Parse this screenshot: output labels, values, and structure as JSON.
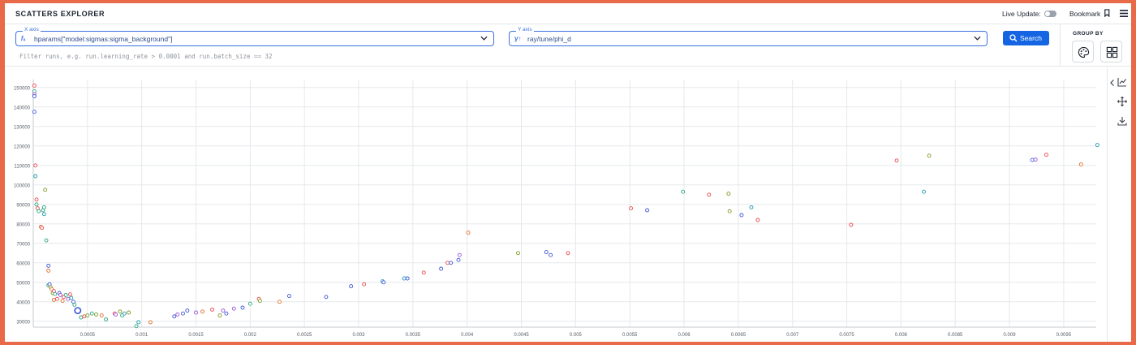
{
  "header": {
    "title": "SCATTERS EXPLORER",
    "live_update_label": "Live Update:",
    "bookmark_label": "Bookmark"
  },
  "controls": {
    "x_axis": {
      "label": "X axis",
      "value": "hparams[\"model:sigmas:sigma_background\"]",
      "icon": "function-icon"
    },
    "y_axis": {
      "label": "Y axis",
      "value": "ray/tune/phi_d",
      "icon": "metric-icon"
    },
    "search_label": "Search",
    "filter_placeholder": "Filter runs, e.g. run.learning_rate > 0.0001 and run.batch_size == 32",
    "group_by_label": "GROUP BY"
  },
  "colors": {
    "accent": "#1565e3",
    "series": [
      "#e8474f",
      "#3c54d6",
      "#2aa37a",
      "#7a9a21",
      "#e36d2b",
      "#9a4fd6",
      "#1f9ab0",
      "#6f7f99"
    ]
  },
  "chart_data": {
    "type": "scatter",
    "xlim": [
      0,
      0.0098
    ],
    "ylim": [
      27000,
      152000
    ],
    "x_ticks": [
      "0.0005",
      "0.001",
      "0.0015",
      "0.002",
      "0.0025",
      "0.003",
      "0.0035",
      "0.004",
      "0.0045",
      "0.005",
      "0.0055",
      "0.006",
      "0.0065",
      "0.007",
      "0.0075",
      "0.008",
      "0.0085",
      "0.009",
      "0.0095"
    ],
    "y_ticks": [
      "30000",
      "40000",
      "50000",
      "60000",
      "70000",
      "80000",
      "90000",
      "100000",
      "110000",
      "120000",
      "130000",
      "140000",
      "150000"
    ],
    "grid": true,
    "points": [
      [
        1e-05,
        151000,
        0
      ],
      [
        1e-05,
        148000,
        2
      ],
      [
        1e-05,
        146500,
        5
      ],
      [
        1e-05,
        145500,
        1
      ],
      [
        1e-05,
        137500,
        1
      ],
      [
        2e-05,
        110000,
        0
      ],
      [
        2e-05,
        104500,
        6
      ],
      [
        3e-05,
        92500,
        0
      ],
      [
        3e-05,
        90000,
        2
      ],
      [
        4e-05,
        88000,
        0
      ],
      [
        5e-05,
        86500,
        2
      ],
      [
        7e-05,
        78500,
        4
      ],
      [
        8e-05,
        78000,
        0
      ],
      [
        9e-05,
        87000,
        2
      ],
      [
        0.0001,
        85000,
        6
      ],
      [
        0.0001,
        88500,
        2
      ],
      [
        0.00011,
        97500,
        3
      ],
      [
        0.00012,
        71500,
        2
      ],
      [
        0.00014,
        58500,
        1
      ],
      [
        0.00014,
        56000,
        4
      ],
      [
        0.00014,
        48500,
        2
      ],
      [
        0.00015,
        49000,
        1
      ],
      [
        0.00016,
        47500,
        3
      ],
      [
        0.00017,
        46500,
        4
      ],
      [
        0.00018,
        44500,
        3
      ],
      [
        0.00019,
        45500,
        0
      ],
      [
        0.00019,
        41000,
        4
      ],
      [
        0.0002,
        44000,
        2
      ],
      [
        0.00022,
        41500,
        0
      ],
      [
        0.00024,
        44500,
        1
      ],
      [
        0.00025,
        43500,
        5
      ],
      [
        0.00027,
        40500,
        4
      ],
      [
        0.00028,
        42500,
        0
      ],
      [
        0.0003,
        43500,
        2
      ],
      [
        0.00032,
        41500,
        5
      ],
      [
        0.00034,
        43800,
        0
      ],
      [
        0.00035,
        42000,
        6
      ],
      [
        0.00037,
        40000,
        1
      ],
      [
        0.00038,
        38500,
        2
      ],
      [
        0.00041,
        35500,
        1,
        1
      ],
      [
        0.00044,
        32000,
        2
      ],
      [
        0.00047,
        32500,
        0
      ],
      [
        0.0005,
        33000,
        3
      ],
      [
        0.00054,
        34000,
        2
      ],
      [
        0.00058,
        33500,
        3
      ],
      [
        0.00063,
        33000,
        4
      ],
      [
        0.00067,
        31000,
        2
      ],
      [
        0.00075,
        34000,
        0
      ],
      [
        0.00076,
        33500,
        5
      ],
      [
        0.0008,
        35000,
        3
      ],
      [
        0.00082,
        33000,
        2
      ],
      [
        0.00084,
        34000,
        6
      ],
      [
        0.00088,
        34500,
        3
      ],
      [
        0.00095,
        27500,
        2
      ],
      [
        0.00097,
        29500,
        6
      ],
      [
        0.00108,
        29500,
        4
      ],
      [
        0.0013,
        32500,
        1
      ],
      [
        0.00133,
        33500,
        5
      ],
      [
        0.00138,
        34000,
        1
      ],
      [
        0.00142,
        35500,
        1
      ],
      [
        0.0015,
        34500,
        5
      ],
      [
        0.00156,
        35000,
        4
      ],
      [
        0.00165,
        36000,
        0
      ],
      [
        0.00172,
        33000,
        3
      ],
      [
        0.00175,
        35500,
        5
      ],
      [
        0.00178,
        34000,
        1
      ],
      [
        0.00185,
        36500,
        5
      ],
      [
        0.00193,
        37000,
        1
      ],
      [
        0.002,
        39000,
        2
      ],
      [
        0.00208,
        41500,
        0
      ],
      [
        0.00209,
        40500,
        3
      ],
      [
        0.00227,
        40000,
        4
      ],
      [
        0.00236,
        43000,
        1
      ],
      [
        0.0027,
        42500,
        1
      ],
      [
        0.00293,
        48000,
        1
      ],
      [
        0.00305,
        49000,
        0
      ],
      [
        0.00322,
        50500,
        6
      ],
      [
        0.00323,
        50000,
        1
      ],
      [
        0.00342,
        52000,
        6
      ],
      [
        0.00345,
        52000,
        1
      ],
      [
        0.0036,
        55000,
        0
      ],
      [
        0.00376,
        57000,
        1
      ],
      [
        0.00382,
        60000,
        0
      ],
      [
        0.00385,
        60000,
        1
      ],
      [
        0.00392,
        61500,
        1
      ],
      [
        0.00393,
        64000,
        5
      ],
      [
        0.00401,
        75500,
        4
      ],
      [
        0.00447,
        65000,
        3
      ],
      [
        0.00473,
        65500,
        1
      ],
      [
        0.00477,
        64000,
        1
      ],
      [
        0.00493,
        65000,
        0
      ],
      [
        0.00551,
        88000,
        0
      ],
      [
        0.00566,
        87000,
        1
      ],
      [
        0.00599,
        96500,
        2
      ],
      [
        0.00623,
        95000,
        0
      ],
      [
        0.00641,
        95500,
        3
      ],
      [
        0.00642,
        86500,
        3
      ],
      [
        0.00653,
        84500,
        1
      ],
      [
        0.00662,
        88500,
        6
      ],
      [
        0.00668,
        82000,
        0
      ],
      [
        0.00754,
        79500,
        0
      ],
      [
        0.00796,
        112500,
        0
      ],
      [
        0.00821,
        96500,
        6
      ],
      [
        0.00826,
        115000,
        3
      ],
      [
        0.00921,
        112800,
        1
      ],
      [
        0.00924,
        113000,
        5
      ],
      [
        0.00934,
        115500,
        0
      ],
      [
        0.00966,
        110500,
        4
      ],
      [
        0.00981,
        120500,
        6
      ]
    ]
  }
}
